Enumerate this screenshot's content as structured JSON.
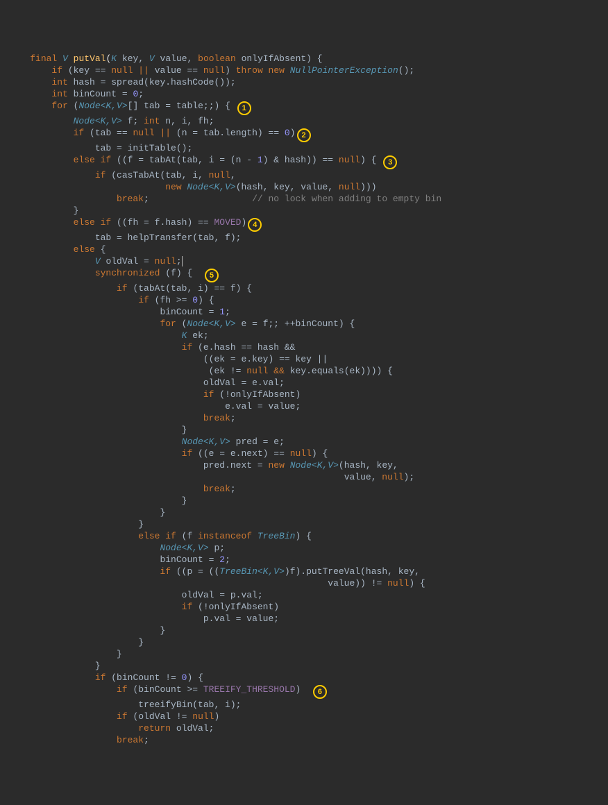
{
  "lines": {
    "l1_final": "final",
    "l1_V": "V",
    "l1_fn": "putVal",
    "l1_K": "K",
    "l1_key": " key, ",
    "l1_V2": "V",
    "l1_value": " value, ",
    "l1_bool": "boolean",
    "l1_only": " onlyIfAbsent) {",
    "l2_if": "if",
    "l2_body": " (key == ",
    "l2_null": "null",
    "l2_or": " || ",
    "l2_body2": "value == ",
    "l2_null2": "null",
    "l2_close": ") ",
    "l2_throw": "throw new",
    "l2_npe": " NullPointerException",
    "l2_end": "();",
    "l3_int": "int",
    "l3_body": " hash = spread(key.hashCode());",
    "l4_int": "int",
    "l4_body": " binCount = ",
    "l4_zero": "0",
    "l4_semi": ";",
    "l5_for": "for",
    "l5_open": " (",
    "l5_node": "Node",
    "l5_gen": "<K,V>",
    "l5_arr": "[] tab = table;;) {",
    "l6_node": "Node",
    "l6_gen": "<K,V>",
    "l6_f": " f; ",
    "l6_int": "int",
    "l6_vars": " n, i, fh;",
    "l7_if": "if",
    "l7_body": " (tab == ",
    "l7_null": "null",
    "l7_or": " || ",
    "l7_expr": "(n = tab.length) == ",
    "l7_zero": "0",
    "l7_close": ")",
    "l8": "tab = initTable();",
    "l9_else": "else if",
    "l9_open": " ((f = tabAt(tab, i = (n - ",
    "l9_one": "1",
    "l9_mid": ") & hash)) == ",
    "l9_null": "null",
    "l9_close": ") {",
    "l10_if": "if",
    "l10_body": " (casTabAt(tab, i, ",
    "l10_null": "null",
    "l10_comma": ",",
    "l11_new": "new",
    "l11_node": " Node",
    "l11_gen": "<K,V>",
    "l11_args": "(hash, key, value, ",
    "l11_null": "null",
    "l11_close": ")))",
    "l12_break": "break",
    "l12_semi": ";",
    "l12_comment": "// no lock when adding to empty bin",
    "l13": "}",
    "l14_else": "else if",
    "l14_expr": " ((fh = f.hash) == ",
    "l14_moved": "MOVED",
    "l14_close": ")",
    "l15": "tab = helpTransfer(tab, f);",
    "l16_else": "else",
    "l16_brace": " {",
    "l17_V": "V",
    "l17_body": " oldVal = ",
    "l17_null": "null",
    "l17_semi": ";",
    "l18_sync": "synchronized",
    "l18_arg": " (f) {",
    "l19_if": "if",
    "l19_body": " (tabAt(tab, i) == f) {",
    "l20_if": "if",
    "l20_body": " (fh >= ",
    "l20_zero": "0",
    "l20_close": ") {",
    "l21": "binCount = ",
    "l21_one": "1",
    "l21_semi": ";",
    "l22_for": "for",
    "l22_open": " (",
    "l22_node": "Node",
    "l22_gen": "<K,V>",
    "l22_body": " e = f;; ++binCount) {",
    "l23_K": "K",
    "l23_ek": " ek;",
    "l24_if": "if",
    "l24_body": " (e.hash == hash &&",
    "l25": "((ek = e.key) == key ||",
    "l26_a": " (ek != ",
    "l26_null": "null",
    "l26_and": " && ",
    "l26_b": "key.equals(ek)))) {",
    "l27": "oldVal = e.val;",
    "l28_if": "if",
    "l28_body": " (!onlyIfAbsent)",
    "l29": "e.val = value;",
    "l30_break": "break",
    "l30_semi": ";",
    "l31": "}",
    "l32_node": "Node",
    "l32_gen": "<K,V>",
    "l32_body": " pred = e;",
    "l33_if": "if",
    "l33_body": " ((e = e.next) == ",
    "l33_null": "null",
    "l33_close": ") {",
    "l34_a": "pred.next = ",
    "l34_new": "new",
    "l34_node": " Node",
    "l34_gen": "<K,V>",
    "l34_args": "(hash, key,",
    "l35_a": "value, ",
    "l35_null": "null",
    "l35_close": ");",
    "l36_break": "break",
    "l36_semi": ";",
    "l37": "}",
    "l38": "}",
    "l39": "}",
    "l40_else": "else if",
    "l40_f": " (f ",
    "l40_inst": "instanceof",
    "l40_tb": " TreeBin",
    "l40_close": ") {",
    "l41_node": "Node",
    "l41_gen": "<K,V>",
    "l41_p": " p;",
    "l42": "binCount = ",
    "l42_two": "2",
    "l42_semi": ";",
    "l43_if": "if",
    "l43_a": " ((p = ((",
    "l43_tb": "TreeBin",
    "l43_gen": "<K,V>",
    "l43_b": ")f).putTreeVal(hash, key,",
    "l44_a": "value)) != ",
    "l44_null": "null",
    "l44_close": ") {",
    "l45": "oldVal = p.val;",
    "l46_if": "if",
    "l46_body": " (!onlyIfAbsent)",
    "l47": "p.val = value;",
    "l48": "}",
    "l49": "}",
    "l50": "}",
    "l51": "}",
    "l52_if": "if",
    "l52_body": " (binCount != ",
    "l52_zero": "0",
    "l52_close": ") {",
    "l53_if": "if",
    "l53_body": " (binCount >= ",
    "l53_tt": "TREEIFY_THRESHOLD",
    "l53_close": ")",
    "l54": "treeifyBin(tab, i);",
    "l55_if": "if",
    "l55_body": " (oldVal != ",
    "l55_null": "null",
    "l55_close": ")",
    "l56_return": "return",
    "l56_val": " oldVal;",
    "l57_break": "break",
    "l57_semi": ";"
  },
  "badges": {
    "b1": "1",
    "b2": "2",
    "b3": "3",
    "b4": "4",
    "b5": "5",
    "b6": "6"
  }
}
